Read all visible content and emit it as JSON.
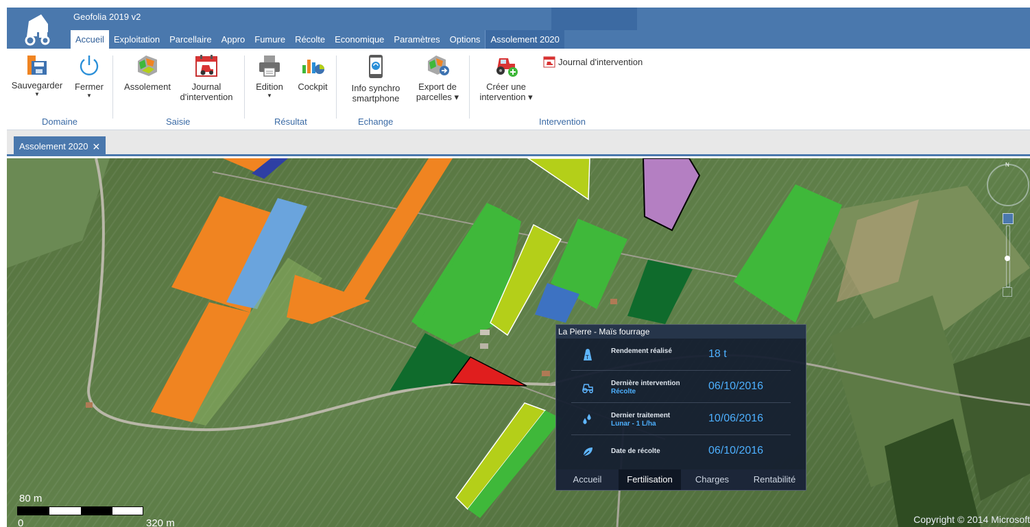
{
  "app": {
    "title": "Geofolia 2019 v2",
    "tabs": [
      {
        "label": "Accueil",
        "state": "active"
      },
      {
        "label": "Exploitation"
      },
      {
        "label": "Parcellaire"
      },
      {
        "label": "Appro"
      },
      {
        "label": "Fumure"
      },
      {
        "label": "Récolte"
      },
      {
        "label": "Economique"
      },
      {
        "label": "Paramètres"
      },
      {
        "label": "Options"
      },
      {
        "label": "Assolement 2020",
        "state": "contextual"
      }
    ]
  },
  "ribbon": {
    "domaine": {
      "label": "Domaine",
      "sauvegarder": "Sauvegarder",
      "fermer": "Fermer"
    },
    "saisie": {
      "label": "Saisie",
      "assolement": "Assolement",
      "journal_line1": "Journal",
      "journal_line2": "d'intervention"
    },
    "resultat": {
      "label": "Résultat",
      "edition": "Edition",
      "cockpit": "Cockpit"
    },
    "echange": {
      "label": "Echange",
      "info_line1": "Info synchro",
      "info_line2": "smartphone",
      "export_line1": "Export de",
      "export_line2": "parcelles"
    },
    "intervention": {
      "label": "Intervention",
      "creer_line1": "Créer une",
      "creer_line2": "intervention",
      "journal_small": "Journal d'intervention"
    }
  },
  "document_tab": {
    "label": "Assolement 2020",
    "close": "✕"
  },
  "popup": {
    "title": "La Pierre - Maïs fourrage",
    "rows": [
      {
        "icon": "weight-icon",
        "label": "Rendement réalisé",
        "sub": "",
        "value": "18 t"
      },
      {
        "icon": "tractor-icon",
        "label": "Dernière intervention",
        "sub": "Récolte",
        "value": "06/10/2016"
      },
      {
        "icon": "drops-icon",
        "label": "Dernier traitement",
        "sub": "Lunar - 1 L/ha",
        "value": "10/06/2016"
      },
      {
        "icon": "leaf-icon",
        "label": "Date de récolte",
        "sub": "",
        "value": "06/10/2016"
      }
    ],
    "tabs": [
      "Accueil",
      "Fertilisation",
      "Charges",
      "Rentabilité"
    ]
  },
  "map": {
    "scale_top": "80 m",
    "scale_zero": "0",
    "scale_end": "320 m",
    "copyright": "Copyright © 2014 Microsoft",
    "compass": "N"
  },
  "colors": {
    "ribbon_blue": "#4a78ad",
    "orange": "#f08421",
    "light_blue": "#6aa4dd",
    "yellow_green": "#b4cf19",
    "green": "#3fb83a",
    "dark_green": "#0f6b2c",
    "purple": "#b47fc2",
    "red": "#e01e1e",
    "popup_value": "#4db0ff"
  }
}
